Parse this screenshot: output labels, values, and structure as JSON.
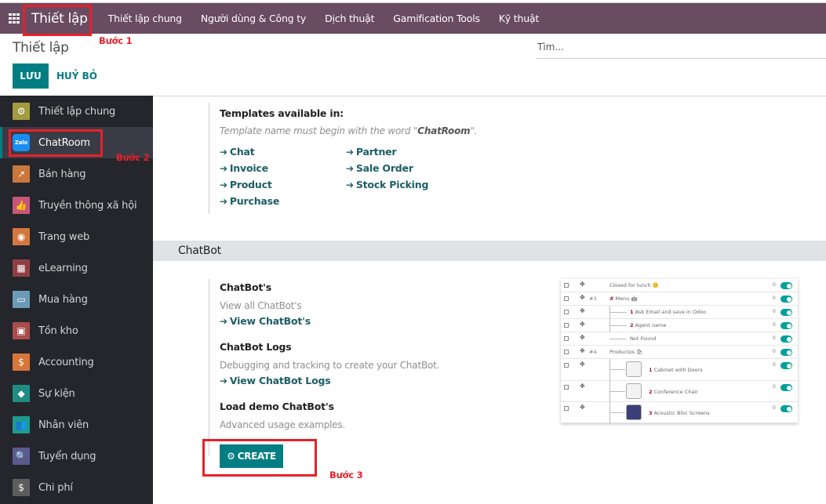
{
  "navbar": {
    "apps_icon": "apps-grid-icon",
    "brand": "Thiết lập",
    "menu": [
      "Thiết lập chung",
      "Người dùng & Công ty",
      "Dịch thuật",
      "Gamification Tools",
      "Kỹ thuật"
    ]
  },
  "annotations": {
    "step1": "Bước 1",
    "step2": "Bước 2",
    "step3": "Bước 3",
    "highlight_color": "#e8202a"
  },
  "control_panel": {
    "title": "Thiết lập",
    "save_label": "LƯU",
    "cancel_label": "HUỶ BỎ",
    "search_placeholder": "Tìm..."
  },
  "sidebar": {
    "active_index": 1,
    "items": [
      {
        "label": "Thiết lập chung",
        "icon": "gear-icon",
        "color": "#a39b3f",
        "glyph": "⚙"
      },
      {
        "label": "ChatRoom",
        "icon": "zalo-icon",
        "color": "#1a8ef0",
        "glyph": "Zalo"
      },
      {
        "label": "Bán hàng",
        "icon": "chart-trend-icon",
        "color": "#c9773c",
        "glyph": "↗"
      },
      {
        "label": "Truyền thông xã hội",
        "icon": "thumbs-up-icon",
        "color": "#c5567a",
        "glyph": "👍"
      },
      {
        "label": "Trang web",
        "icon": "globe-icon",
        "color": "#d4773f",
        "glyph": "◉"
      },
      {
        "label": "eLearning",
        "icon": "presentation-icon",
        "color": "#8f3f44",
        "glyph": "▦"
      },
      {
        "label": "Mua hàng",
        "icon": "credit-card-icon",
        "color": "#6a9bb5",
        "glyph": "▭"
      },
      {
        "label": "Tồn kho",
        "icon": "box-icon",
        "color": "#a84c4c",
        "glyph": "▣"
      },
      {
        "label": "Accounting",
        "icon": "invoice-dollar-icon",
        "color": "#d6763a",
        "glyph": "$"
      },
      {
        "label": "Sự kiện",
        "icon": "ticket-icon",
        "color": "#1f8c84",
        "glyph": "◆"
      },
      {
        "label": "Nhân viên",
        "icon": "users-icon",
        "color": "#1e9a91",
        "glyph": "👥"
      },
      {
        "label": "Tuyển dụng",
        "icon": "search-user-icon",
        "color": "#5b5a8f",
        "glyph": "🔍"
      },
      {
        "label": "Chi phí",
        "icon": "user-dollar-icon",
        "color": "#5d5d5d",
        "glyph": "$"
      }
    ]
  },
  "templates": {
    "heading": "Templates available in:",
    "note_prefix": "Template name must begin with the word \"",
    "note_keyword": "ChatRoom",
    "note_suffix": "\".",
    "links_col1": [
      "Chat",
      "Invoice",
      "Product",
      "Purchase"
    ],
    "links_col2": [
      "Partner",
      "Sale Order",
      "Stock Picking"
    ]
  },
  "chatbot": {
    "section_title": "ChatBot",
    "chatbots_heading": "ChatBot's",
    "chatbots_desc": "View all ChatBot's",
    "chatbots_link": "View ChatBot's",
    "logs_heading": "ChatBot Logs",
    "logs_desc": "Debugging and tracking to create your ChatBot.",
    "logs_link": "View ChatBot Logs",
    "demo_heading": "Load demo ChatBot's",
    "demo_desc": "Advanced usage examples.",
    "create_label": "CREATE"
  },
  "preview": {
    "rows": [
      {
        "seq": "",
        "num": "",
        "text": "Closed for lunch 🙂",
        "count": "0"
      },
      {
        "seq": "#3",
        "num": "#",
        "text": "Menu 🤖",
        "count": "0"
      },
      {
        "seq": "",
        "num": "1",
        "text": "Ask Email and save in Odoo",
        "count": "0"
      },
      {
        "seq": "",
        "num": "2",
        "text": "Agent name",
        "count": "0"
      },
      {
        "seq": "",
        "num": "",
        "text": "Not Found",
        "count": "0"
      },
      {
        "seq": "#4",
        "num": "",
        "text": "Productos 🛍",
        "count": "0"
      },
      {
        "seq": "",
        "num": "1",
        "text": "Cabinet with Doors",
        "count": "0"
      },
      {
        "seq": "",
        "num": "2",
        "text": "Conference Chair",
        "count": "0"
      },
      {
        "seq": "",
        "num": "3",
        "text": "Acoustic Bloc Screens",
        "count": "0"
      }
    ]
  }
}
